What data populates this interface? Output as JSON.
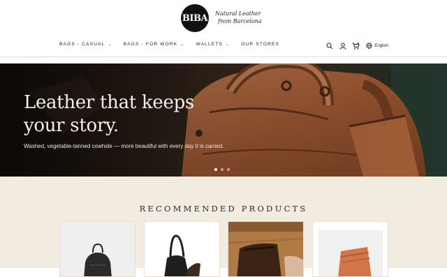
{
  "brand": {
    "logo_text": "BIBA",
    "tagline_line1": "Natural Leather",
    "tagline_line2": "from Barcelona"
  },
  "nav": {
    "items": [
      {
        "label": "BAGS - CASUAL"
      },
      {
        "label": "BAGS - FOR WORK"
      },
      {
        "label": "WALLETS"
      },
      {
        "label": "OUR STORES"
      }
    ]
  },
  "header_actions": {
    "language": "English",
    "icons": [
      "search-icon",
      "user-icon",
      "cart-icon",
      "globe-icon"
    ]
  },
  "hero": {
    "title": "Leather that keeps your story.",
    "subtitle": "Washed, vegetable-tanned cowhide — more beautiful with every day it is carried.",
    "slides": 3,
    "active_slide": 1
  },
  "recommended": {
    "title": "RECOMMENDED PRODUCTS",
    "products": [
      {
        "image": "black-backpack"
      },
      {
        "image": "black-shoulder-bag"
      },
      {
        "image": "brown-wallet-on-wood"
      },
      {
        "image": "tan-wallet"
      }
    ]
  },
  "colors": {
    "accent_cream": "#f2ece0",
    "leather_brown": "#9a5a34",
    "text_dark": "#222222"
  }
}
